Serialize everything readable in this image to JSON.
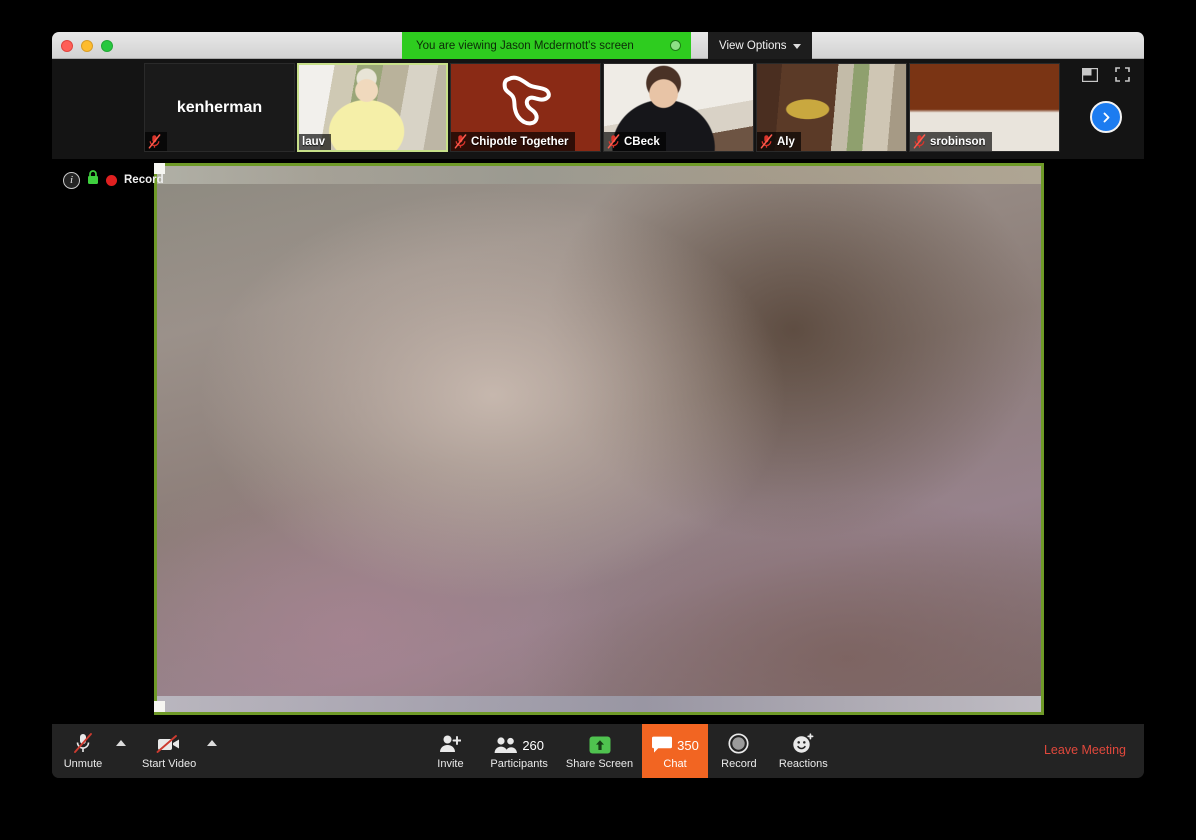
{
  "window": {
    "traffic_lights": [
      "close",
      "minimize",
      "zoom"
    ],
    "sharing_banner": {
      "text": "You are viewing Jason Mcdermott's screen",
      "indicator_icon": "share-status-indicator",
      "banner_color": "#2ecc1f"
    },
    "view_options": {
      "label": "View Options",
      "caret_icon": "chevron-down-icon"
    }
  },
  "filmstrip": {
    "tiles": [
      {
        "name": "kenherman",
        "display": "center",
        "muted": true,
        "active": false,
        "bg": "bg-kenherman"
      },
      {
        "name": "lauv",
        "display": "corner",
        "muted": false,
        "active": true,
        "bg": "bg-lauv"
      },
      {
        "name": "Chipotle Together",
        "display": "corner",
        "muted": true,
        "active": false,
        "bg": "bg-chipotle"
      },
      {
        "name": "CBeck",
        "display": "corner",
        "muted": true,
        "active": false,
        "bg": "bg-cbeck"
      },
      {
        "name": "Aly",
        "display": "corner",
        "muted": true,
        "active": false,
        "bg": "bg-aly"
      },
      {
        "name": "srobinson",
        "display": "corner",
        "muted": true,
        "active": false,
        "bg": "bg-srobinson"
      }
    ],
    "controls": {
      "pip_icon": "picture-in-picture-icon",
      "fullscreen_icon": "fullscreen-icon",
      "next_page_icon": "chevron-right-icon",
      "next_page_color": "#1c7cf0"
    }
  },
  "stage": {
    "info_icon": "info-icon",
    "lock_icon": "lock-icon",
    "recording_dot_icon": "recording-dot-icon",
    "recording_label": "Record",
    "shared_screen_border_color": "#6f9a28",
    "shared_screen_alt": "shared-screen-content"
  },
  "toolbar": {
    "items": [
      {
        "id": "mute",
        "label": "Unmute",
        "icon": "microphone-muted-icon",
        "has_chevron": true,
        "badge": "",
        "highlight": false
      },
      {
        "id": "video",
        "label": "Start Video",
        "icon": "camera-off-icon",
        "has_chevron": true,
        "badge": "",
        "highlight": false
      },
      {
        "id": "invite",
        "label": "Invite",
        "icon": "add-person-icon",
        "has_chevron": false,
        "badge": "",
        "highlight": false
      },
      {
        "id": "participants",
        "label": "Participants",
        "icon": "people-icon",
        "has_chevron": false,
        "badge": "260",
        "highlight": false
      },
      {
        "id": "share-screen",
        "label": "Share Screen",
        "icon": "share-screen-icon",
        "has_chevron": false,
        "badge": "",
        "highlight": false
      },
      {
        "id": "chat",
        "label": "Chat",
        "icon": "chat-bubble-icon",
        "has_chevron": false,
        "badge": "350",
        "highlight": true
      },
      {
        "id": "record",
        "label": "Record",
        "icon": "record-circle-icon",
        "has_chevron": false,
        "badge": "",
        "highlight": false
      },
      {
        "id": "reactions",
        "label": "Reactions",
        "icon": "reactions-smiley-icon",
        "has_chevron": false,
        "badge": "",
        "highlight": false
      }
    ],
    "leave_meeting": {
      "label": "Leave Meeting",
      "color": "#e0483c"
    },
    "chat_highlight_color": "#f26522",
    "share_screen_icon_color": "#4fc24f"
  }
}
